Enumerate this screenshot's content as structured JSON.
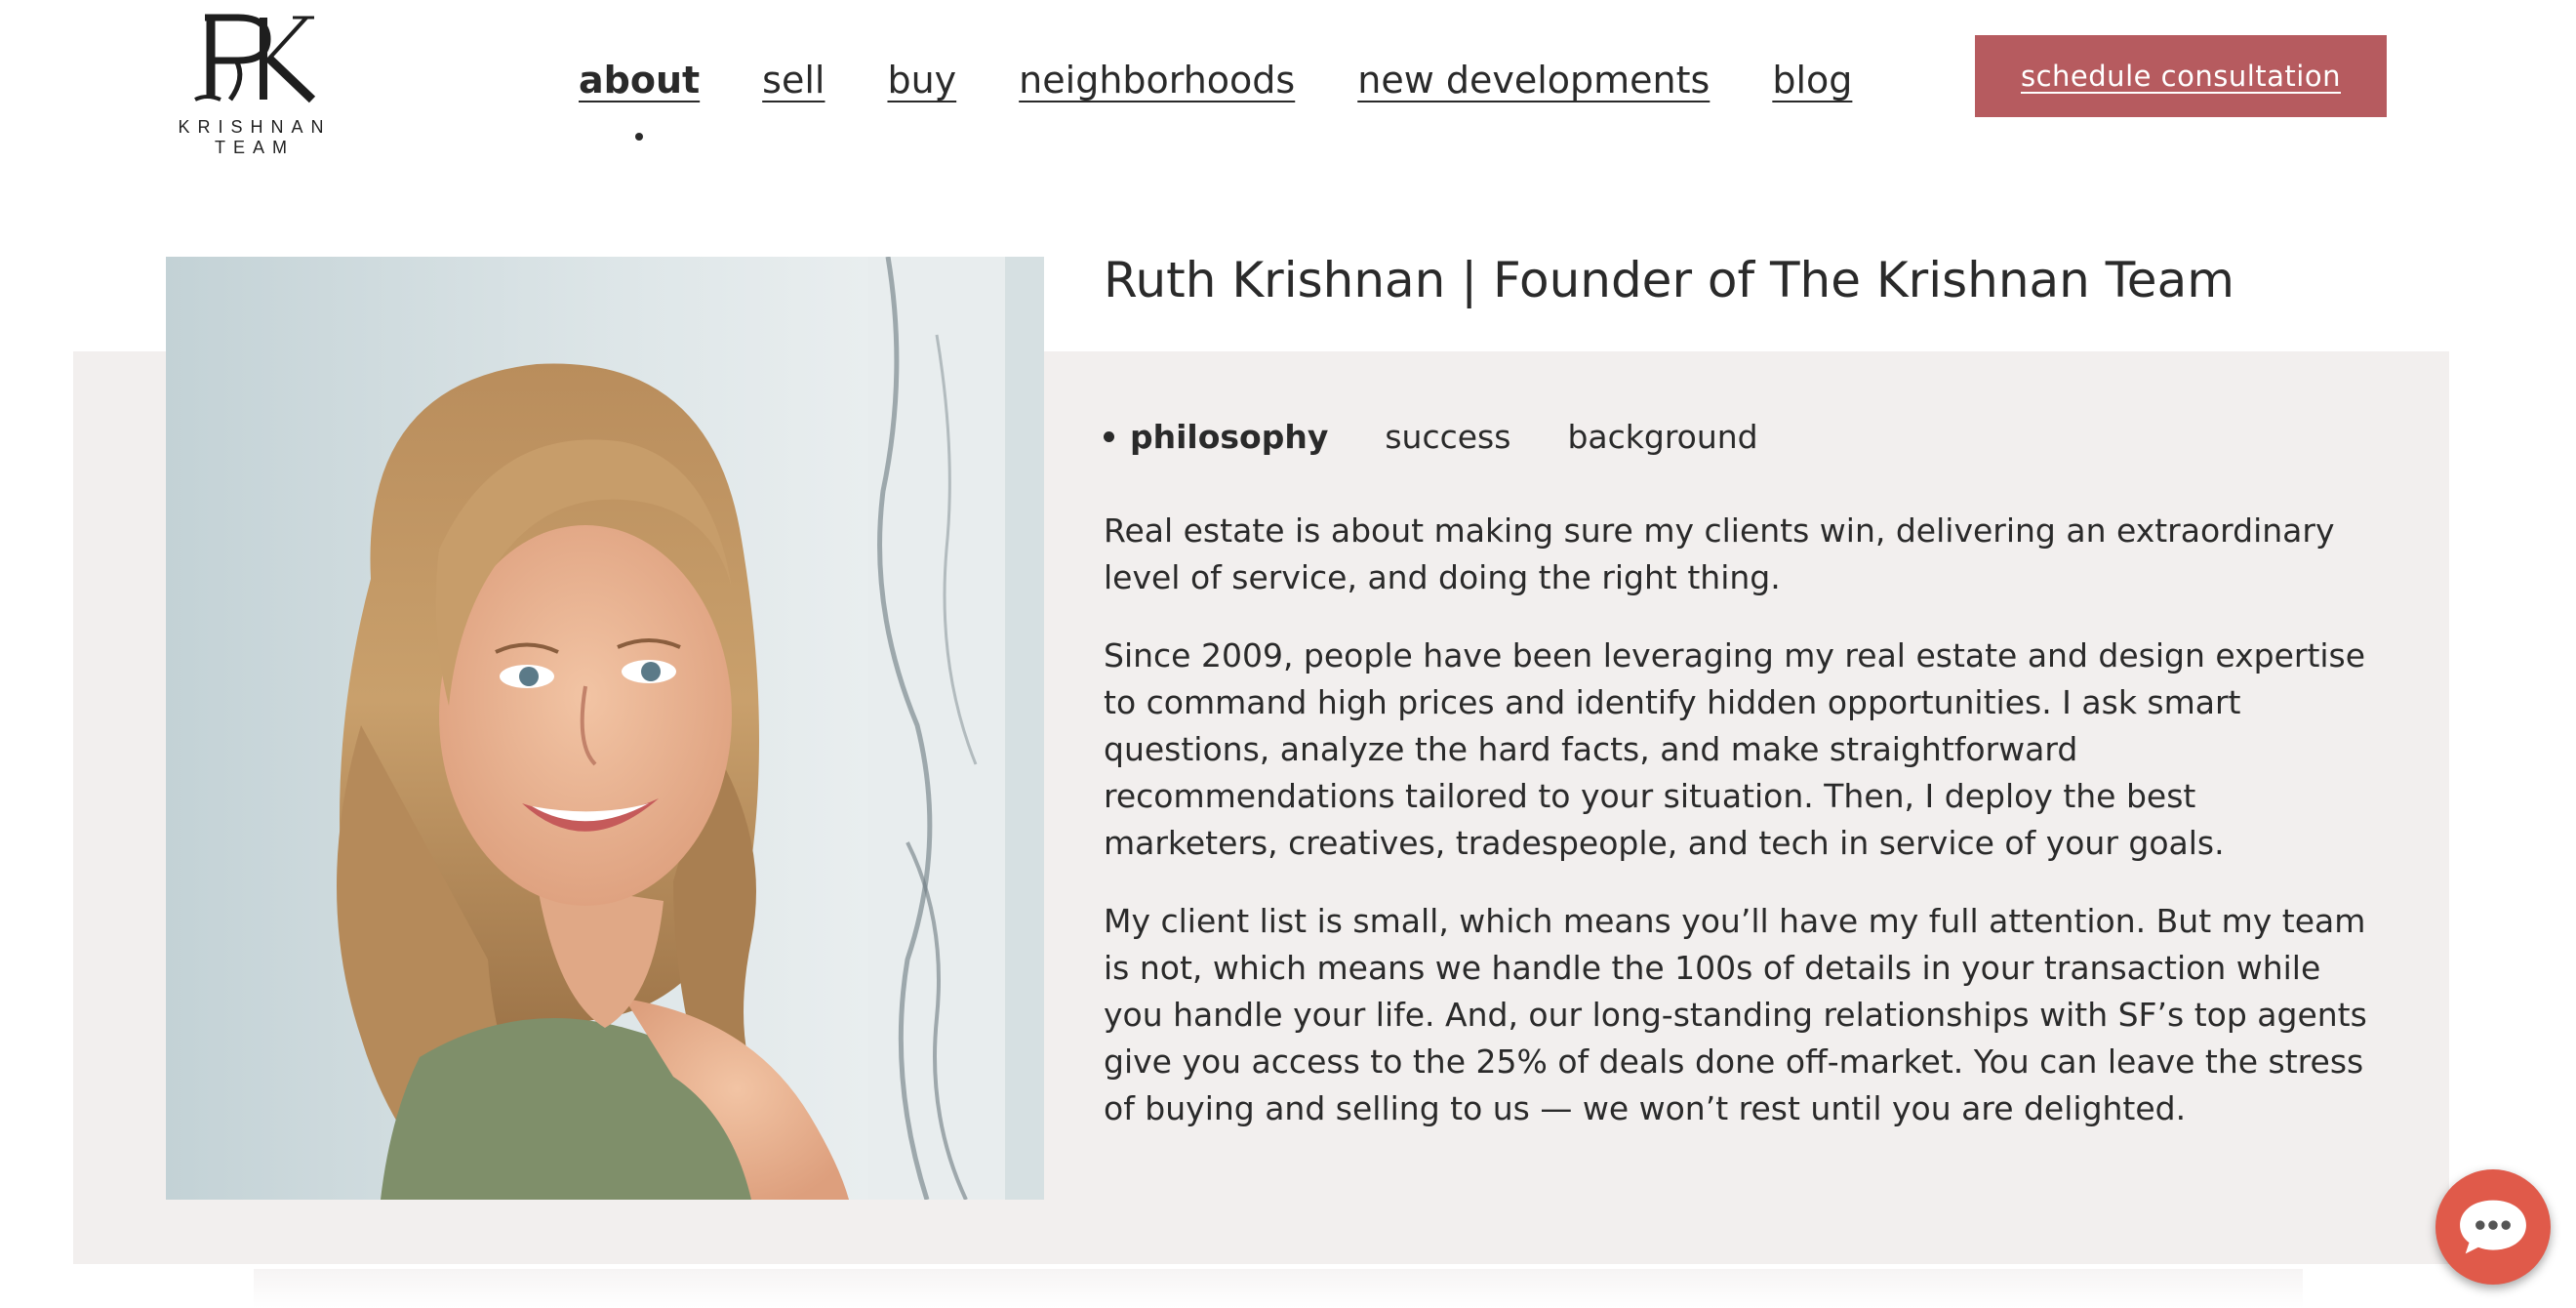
{
  "brand": {
    "logo_text": "KRISHNAN TEAM",
    "logo_mark": "RK"
  },
  "nav": {
    "items": [
      {
        "label": "about",
        "active": true
      },
      {
        "label": "sell"
      },
      {
        "label": "buy"
      },
      {
        "label": "neighborhoods"
      },
      {
        "label": "new developments"
      },
      {
        "label": "blog"
      }
    ]
  },
  "cta": {
    "label": "schedule consultation",
    "color": "#b65b5f"
  },
  "profile": {
    "title": "Ruth Krishnan | Founder of The Krishnan Team",
    "photo_alt": "portrait-photo"
  },
  "tabs": [
    {
      "label": "philosophy",
      "active": true
    },
    {
      "label": "success"
    },
    {
      "label": "background"
    }
  ],
  "paragraphs": [
    "Real estate is about making sure my clients win, delivering an extraordinary level of service, and doing the right thing.",
    "Since 2009, people have been leveraging my real estate and design expertise to command high prices and identify hidden opportunities. I ask smart questions, analyze the hard facts, and make straightforward recommendations tailored to your situation. Then, I deploy the best marketers, creatives, tradespeople, and tech in service of your goals.",
    "My client list is small, which means you’ll have my full attention. But my team is not, which means we handle the 100s of details in your transaction while you handle your life. And, our long-standing relationships with SF’s top agents give you access to the 25% of deals done off-market. You can leave the stress of buying and selling to us — we won’t rest until you are delighted."
  ],
  "chat": {
    "icon": "chat-bubble-icon",
    "color": "#e05a4a"
  }
}
